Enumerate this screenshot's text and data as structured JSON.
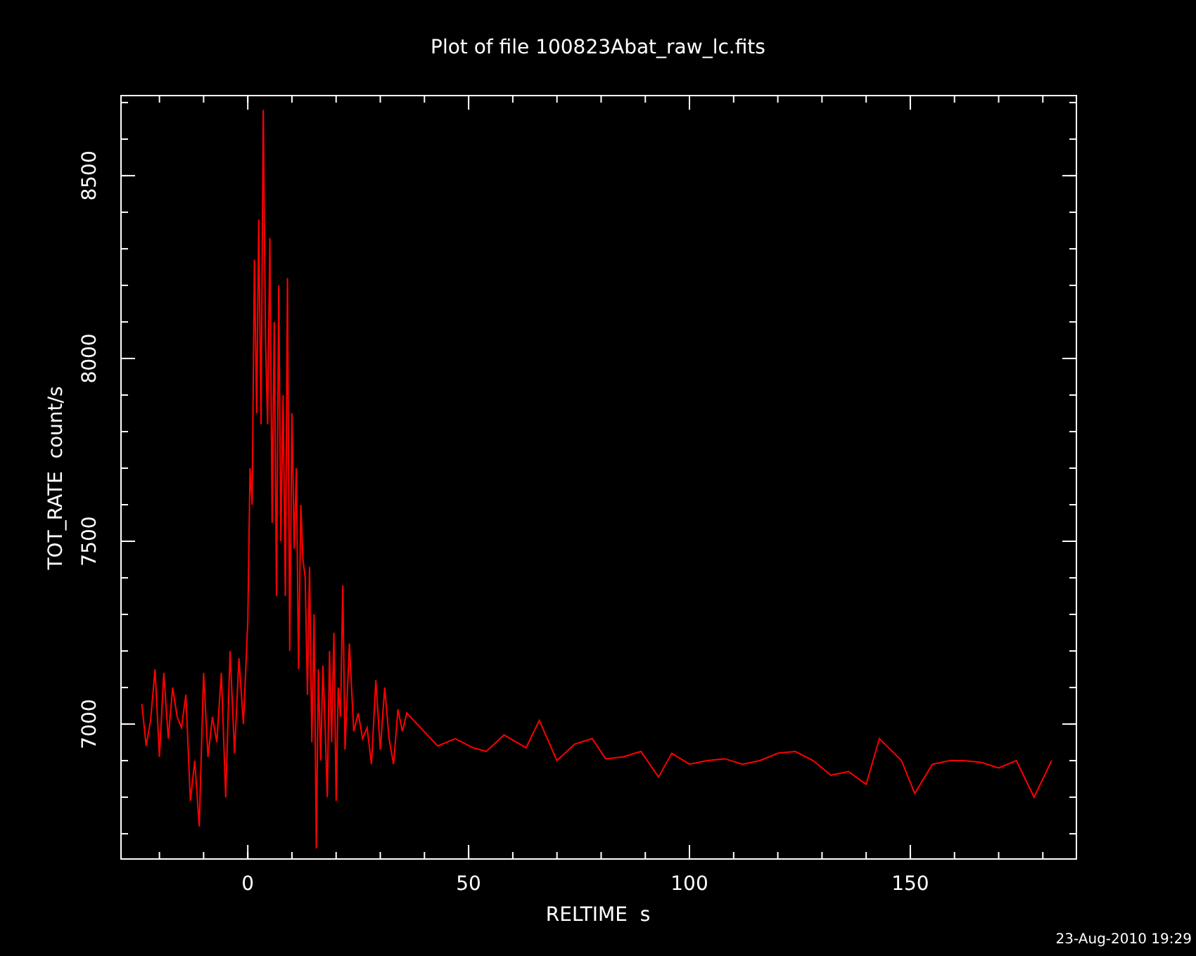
{
  "chart_data": {
    "type": "line",
    "title": "Plot of file 100823Abat_raw_lc.fits",
    "xlabel": "RELTIME  s",
    "ylabel": "TOT_RATE  count/s",
    "x": [
      -24,
      -23,
      -22,
      -21,
      -20,
      -19,
      -18,
      -17,
      -16,
      -15,
      -14,
      -13,
      -12,
      -11,
      -10,
      -9,
      -8,
      -7,
      -6,
      -5,
      -4,
      -3,
      -2,
      -1,
      0,
      0.5,
      1,
      1.5,
      2,
      2.5,
      3,
      3.5,
      4,
      4.5,
      5,
      5.5,
      6,
      6.5,
      7,
      7.5,
      8,
      8.5,
      9,
      9.5,
      10,
      10.5,
      11,
      11.5,
      12,
      12.5,
      13,
      13.5,
      14,
      14.5,
      15,
      15.5,
      16,
      16.5,
      17,
      17.5,
      18,
      18.5,
      19,
      19.5,
      20,
      20.5,
      21,
      21.5,
      22,
      23,
      24,
      25,
      26,
      27,
      28,
      29,
      30,
      31,
      32,
      33,
      34,
      35,
      36,
      43,
      47,
      51,
      54,
      58,
      63,
      66,
      70,
      74,
      78,
      81,
      85,
      89,
      93,
      96,
      100,
      104,
      108,
      112,
      116,
      120,
      124,
      128,
      132,
      136,
      140,
      143,
      148,
      151,
      155,
      159,
      162,
      166,
      170,
      174,
      178,
      182
    ],
    "series": [
      {
        "color": "#ff0000",
        "values": [
          7055,
          6940,
          7010,
          7150,
          6910,
          7140,
          6960,
          7100,
          7020,
          6990,
          7080,
          6790,
          6900,
          6720,
          7140,
          6910,
          7020,
          6950,
          7140,
          6800,
          7200,
          6920,
          7180,
          7000,
          7280,
          7700,
          7600,
          8270,
          7850,
          8380,
          7820,
          8680,
          8050,
          7820,
          8330,
          7550,
          8100,
          7350,
          8200,
          7500,
          7900,
          7350,
          8220,
          7200,
          7850,
          7480,
          7700,
          7150,
          7600,
          7450,
          7400,
          7080,
          7430,
          6950,
          7300,
          6660,
          7150,
          6900,
          7160,
          7000,
          6800,
          7200,
          6950,
          7250,
          6790,
          7100,
          7020,
          7380,
          6930,
          7220,
          6980,
          7030,
          6960,
          6990,
          6890,
          7120,
          6930,
          7100,
          6960,
          6890,
          7040,
          6980,
          7030,
          6940,
          6960,
          6935,
          6925,
          6970,
          6935,
          7010,
          6900,
          6945,
          6960,
          6905,
          6910,
          6925,
          6855,
          6920,
          6890,
          6900,
          6905,
          6890,
          6900,
          6920,
          6925,
          6900,
          6860,
          6870,
          6835,
          6960,
          6900,
          6810,
          6890,
          6900,
          6900,
          6895,
          6880,
          6900,
          6800,
          6900
        ]
      }
    ],
    "xlim": [
      -28.7,
      187.6
    ],
    "ylim": [
      6631,
      8719
    ],
    "xticks": [
      0,
      50,
      100,
      150
    ],
    "yticks": [
      7000,
      7500,
      8000,
      8500
    ]
  },
  "timestamp": "23-Aug-2010 19:29"
}
